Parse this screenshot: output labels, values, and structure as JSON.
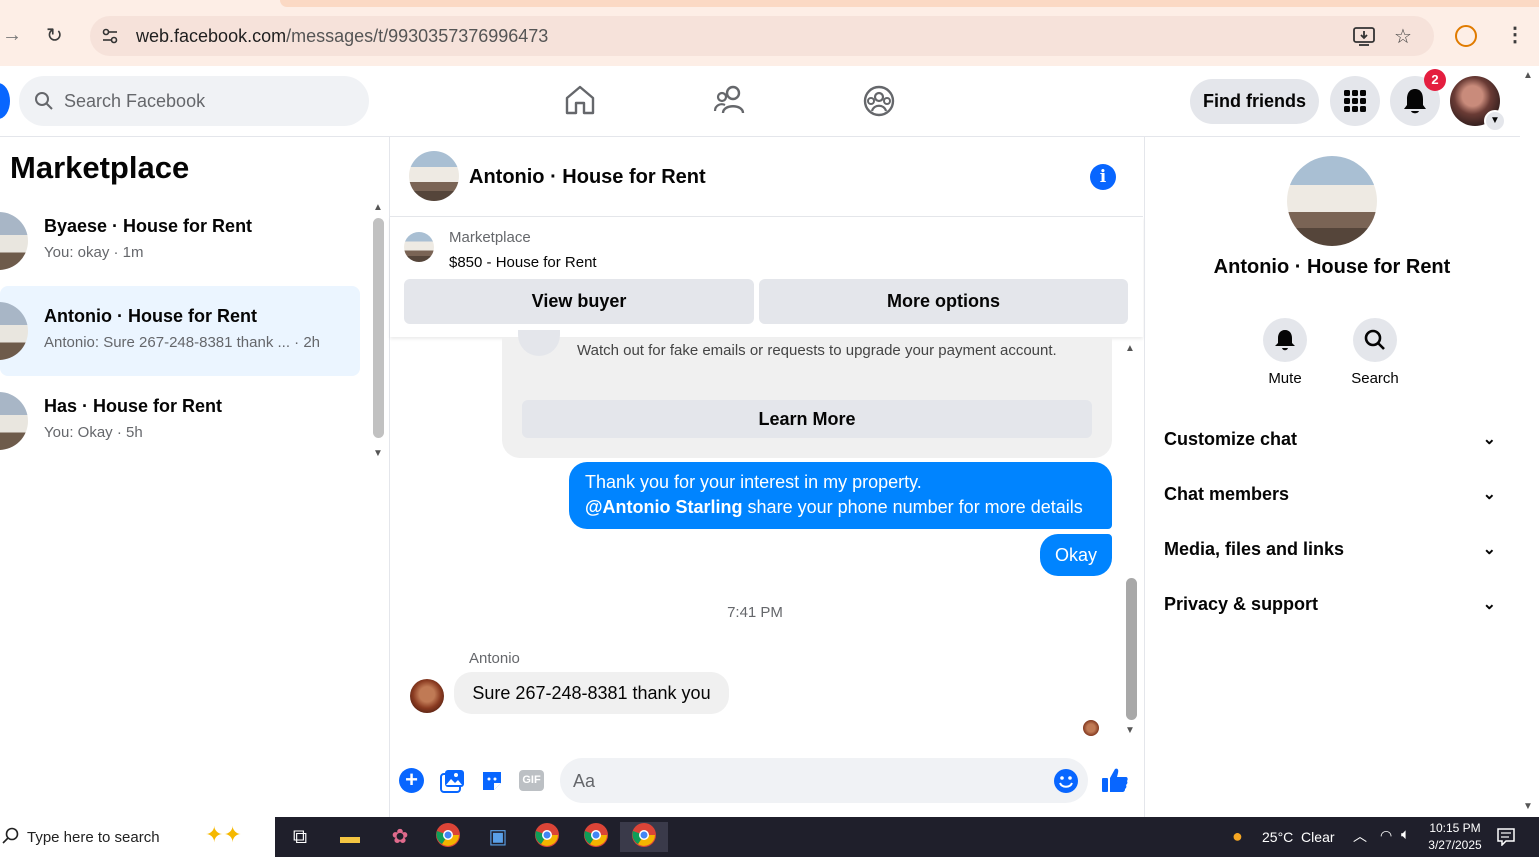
{
  "browser": {
    "url_host": "web.facebook.com",
    "url_path": "/messages/t/9930357376996473"
  },
  "fb_nav": {
    "search_placeholder": "Search Facebook",
    "find_friends_label": "Find friends",
    "notification_count": "2"
  },
  "sidebar": {
    "title": "Marketplace",
    "conversations": [
      {
        "name": "Byaese · House for Rent",
        "preview": "You: okay · 1m"
      },
      {
        "name": "Antonio · House for Rent",
        "preview": "Antonio: Sure 267-248-8381 thank ... · 2h"
      },
      {
        "name": "Has · House for Rent",
        "preview": "You: Okay · 5h"
      }
    ]
  },
  "chat": {
    "title": "Antonio · House for Rent",
    "marketplace_label": "Marketplace",
    "listing": "$850 - House for Rent",
    "view_buyer_label": "View buyer",
    "more_options_label": "More options",
    "warning_text": "Watch out for fake emails or requests to upgrade your payment account.",
    "learn_more_label": "Learn More",
    "messages": {
      "sent_1_line1": "Thank you for your interest in my property.",
      "sent_1_mention": "@Antonio Starling",
      "sent_1_rest": " share your phone number for more details",
      "sent_2": "Okay",
      "timestamp": "7:41 PM",
      "sender_name": "Antonio",
      "received_1": "Sure 267-248-8381 thank you"
    },
    "composer_placeholder": "Aa"
  },
  "details_panel": {
    "name": "Antonio · House for Rent",
    "mute_label": "Mute",
    "search_label": "Search",
    "sections": [
      "Customize chat",
      "Chat members",
      "Media, files and links",
      "Privacy & support"
    ]
  },
  "taskbar": {
    "search_placeholder": "Type here to search",
    "weather": "25°C  Clear",
    "time": "10:15 PM",
    "date": "3/27/2025"
  },
  "colors": {
    "accent": "#0866ff",
    "bubble_blue": "#0084ff",
    "badge_red": "#e41e3f"
  }
}
